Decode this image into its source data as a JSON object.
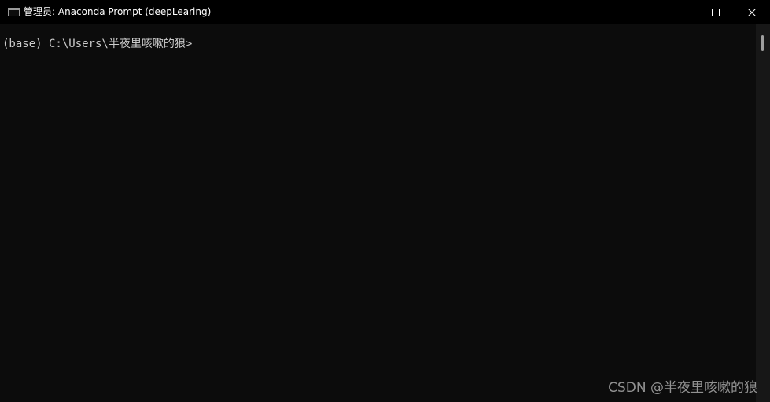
{
  "window": {
    "title": "管理员: Anaconda Prompt (deepLearing)"
  },
  "caption_buttons": {
    "minimize_icon": "minimize-icon",
    "maximize_icon": "maximize-icon",
    "close_icon": "close-icon"
  },
  "console": {
    "prompt": "(base) C:\\Users\\半夜里咳嗽的狼>"
  },
  "watermark": {
    "text": "CSDN @半夜里咳嗽的狼"
  },
  "colors": {
    "titlebar_bg": "#000000",
    "console_bg": "#0c0c0c",
    "console_text": "#cccccc",
    "title_text": "#ffffff",
    "scrollbar_thumb": "#9e9e9e"
  }
}
